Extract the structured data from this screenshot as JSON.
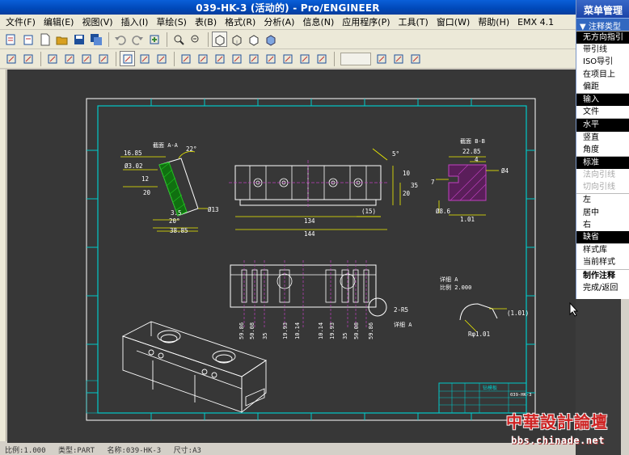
{
  "window": {
    "title": "039-HK-3 (活动的) - Pro/ENGINEER"
  },
  "menubar": {
    "items": [
      "文件(F)",
      "编辑(E)",
      "视图(V)",
      "插入(I)",
      "草绘(S)",
      "表(B)",
      "格式(R)",
      "分析(A)",
      "信息(N)",
      "应用程序(P)",
      "工具(T)",
      "窗口(W)",
      "帮助(H)",
      "EMX 4.1"
    ]
  },
  "toolbar1": {
    "icons": [
      "new-drawing-icon",
      "new-drawing-alt-icon",
      "new-icon",
      "open-icon",
      "save-icon",
      "save-copy-icon",
      "undo-icon",
      "redo-icon",
      "regenerate-icon",
      "zoom-window-icon",
      "zoom-out-icon",
      "wireframe-icon",
      "hidden-line-icon",
      "no-hidden-icon",
      "shaded-icon"
    ]
  },
  "toolbar2": {
    "icons": [
      "delete-icon",
      "show-annotations-icon",
      "refresh-icon",
      "move-view-icon",
      "arrange-icon",
      "align-icon",
      "text-style-icon",
      "create-note-icon",
      "hatch-icon",
      "dimension-icon",
      "table-icon",
      "balloon-icon",
      "snap-icon",
      "surface-finish-icon",
      "datum-icon",
      "grid-icon",
      "layer-icon",
      "parameter-icon",
      "draft-line-icon",
      "draft-chain-icon",
      "draft-arc-icon"
    ],
    "input_value": ""
  },
  "menu_manager": {
    "title": "菜单管理",
    "subtitle": "注释类型",
    "groups": [
      {
        "items": [
          {
            "label": "无方向指引",
            "state": "selected"
          },
          {
            "label": "带引线",
            "state": "normal"
          },
          {
            "label": "ISO导引",
            "state": "normal"
          },
          {
            "label": "在项目上",
            "state": "normal"
          },
          {
            "label": "偏距",
            "state": "normal"
          }
        ]
      },
      {
        "items": [
          {
            "label": "输入",
            "state": "selected"
          },
          {
            "label": "文件",
            "state": "normal"
          }
        ]
      },
      {
        "items": [
          {
            "label": "水平",
            "state": "selected"
          },
          {
            "label": "竖直",
            "state": "normal"
          },
          {
            "label": "角度",
            "state": "normal"
          }
        ]
      },
      {
        "items": [
          {
            "label": "标准",
            "state": "selected"
          },
          {
            "label": "法向引线",
            "state": "disabled"
          },
          {
            "label": "切向引线",
            "state": "disabled"
          }
        ]
      },
      {
        "items": [
          {
            "label": "左",
            "state": "normal"
          },
          {
            "label": "居中",
            "state": "normal"
          },
          {
            "label": "右",
            "state": "normal"
          },
          {
            "label": "缺省",
            "state": "selected"
          }
        ]
      },
      {
        "items": [
          {
            "label": "样式库",
            "state": "normal"
          },
          {
            "label": "当前样式",
            "state": "normal"
          }
        ]
      },
      {
        "items": [
          {
            "label": "制作注释",
            "state": "bold"
          },
          {
            "label": "完成/返回",
            "state": "normal"
          }
        ]
      }
    ]
  },
  "statusbar": {
    "scale": "比例:1.000",
    "type": "类型:PART",
    "name": "名称:039-HK-3",
    "size": "尺寸:A3"
  },
  "drawing": {
    "section_aa_label": "截面 A-A",
    "section_bb_label": "截面 B-B",
    "detail_label": "详细 A",
    "detail_scale": "比例 2.000",
    "detail_callout": "详细 A",
    "dims_aa": [
      "16.85",
      "22°",
      "Ø3.02",
      "12",
      "20",
      "3.5",
      "20°",
      "38.85",
      "Ø13"
    ],
    "dims_front": [
      "134",
      "(15)",
      "144",
      "5°",
      "35",
      "20",
      "10"
    ],
    "dims_bb": [
      "22.85",
      "4",
      "Ø4",
      "7",
      "Ø8.6",
      "1.01"
    ],
    "dims_bottom": [
      "59.86",
      "50.08",
      "35",
      "19.93",
      "10.14",
      "10.14",
      "19.93",
      "35",
      "50.08",
      "59.86"
    ],
    "detail_dims": [
      "(1.01)",
      "Rφ1.01"
    ],
    "callout_radius": "2-R5",
    "title_block_name": "钻模板",
    "title_block_code": "039-HK-3"
  },
  "watermark": {
    "text": "中華設計論壇",
    "url": "bbs.chinade.net"
  },
  "colors": {
    "graphics_bg": "#373737",
    "border_cyan": "#00c8c8",
    "geometry_white": "#ffffff",
    "dimension_yellow": "#f0f000",
    "hatch_green": "#20c020",
    "hatch_magenta": "#c040c0",
    "titlebar_blue": "#0048b8"
  }
}
